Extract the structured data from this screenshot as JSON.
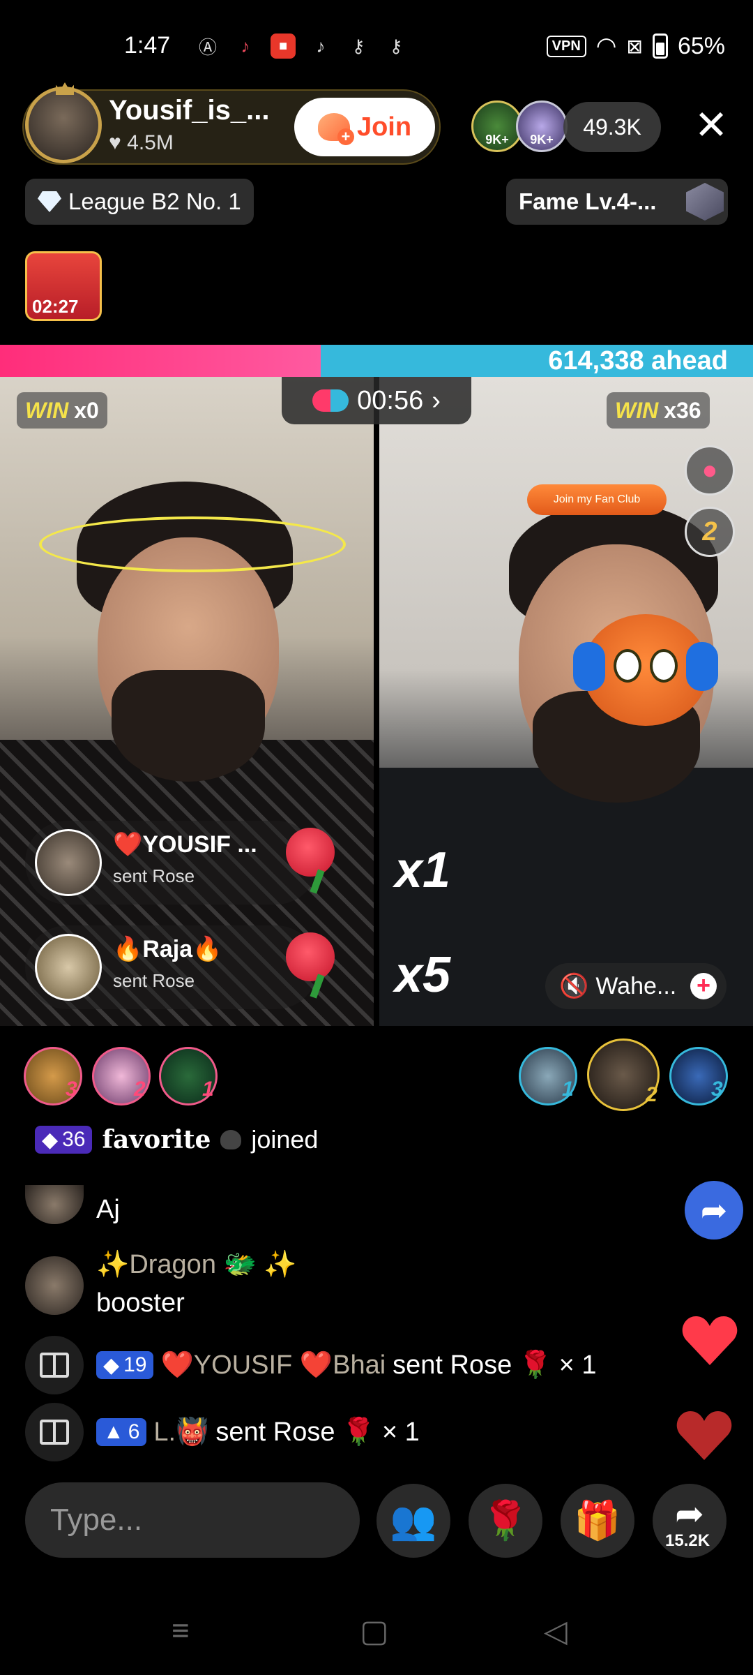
{
  "status_bar": {
    "time": "1:47",
    "vpn": "VPN",
    "battery": "65%"
  },
  "host": {
    "name": "Yousif_is_...",
    "likes": "♥ 4.5M",
    "join_label": "Join"
  },
  "viewers": {
    "top1_badge": "9K+",
    "top2_badge": "9K+",
    "count": "49.3K",
    "close": "✕"
  },
  "league": {
    "label": "League B2 No. 1"
  },
  "fame": {
    "label": "Fame Lv.4-..."
  },
  "chest": {
    "timer": "02:27"
  },
  "battle": {
    "ahead_text": "614,338 ahead",
    "left_win_word": "WIN",
    "left_win_count": "x0",
    "right_win_word": "WIN",
    "right_win_count": "x36",
    "timer": "00:56",
    "timer_chevron": "›"
  },
  "gift_feed": [
    {
      "name": "❤️YOUSIF ...",
      "action": "sent Rose"
    },
    {
      "name": "🔥Raja🔥",
      "action": "sent Rose"
    }
  ],
  "multipliers": {
    "first": "x1",
    "second": "x5"
  },
  "right_side_badge": "2",
  "fan_club_sign": "Join my Fan Club",
  "opponent": {
    "name": "Wahe...",
    "add": "+"
  },
  "rank_left": [
    "3",
    "2",
    "1"
  ],
  "rank_right": [
    "1",
    "2",
    "3"
  ],
  "chat": {
    "joined": {
      "level": "36",
      "name": "favorite",
      "action": "joined"
    },
    "messages": [
      {
        "user": "",
        "text": "Aj"
      },
      {
        "user": "✨Dragon 🐲 ✨",
        "text": "booster"
      }
    ],
    "gifts": [
      {
        "level": "19",
        "user": "❤️YOUSIF ❤️Bhai",
        "action": "sent Rose",
        "emoji": "🌹",
        "count": "× 1"
      },
      {
        "level": "6",
        "user": "L.👹",
        "action": "sent Rose",
        "emoji": "🌹",
        "count": "× 1"
      }
    ]
  },
  "bottom_bar": {
    "placeholder": "Type...",
    "share_count": "15.2K"
  },
  "colors": {
    "pink": "#ff2d7a",
    "cyan": "#36b9dc",
    "gold": "#c9a24a"
  }
}
